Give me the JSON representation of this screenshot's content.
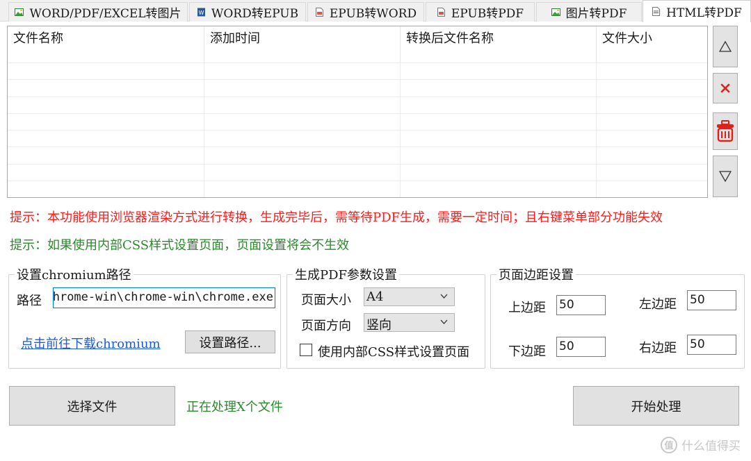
{
  "tabs": [
    {
      "label": "WORD/PDF/EXCEL转图片",
      "icon": "image-icon",
      "active": false
    },
    {
      "label": "WORD转EPUB",
      "icon": "word-doc-icon",
      "active": false
    },
    {
      "label": "EPUB转WORD",
      "icon": "epub-doc-icon",
      "active": false
    },
    {
      "label": "EPUB转PDF",
      "icon": "epub-doc-icon",
      "active": false
    },
    {
      "label": "图片转PDF",
      "icon": "image-icon",
      "active": false
    },
    {
      "label": "HTML转PDF",
      "icon": "html-doc-icon",
      "active": true
    }
  ],
  "file_list": {
    "columns": [
      "文件名称",
      "添加时间",
      "转换后文件名称",
      "文件大小"
    ],
    "rows": []
  },
  "side_buttons": {
    "move_up": "move-up-icon",
    "remove": "close-icon",
    "clear": "trash-icon",
    "move_down": "move-down-icon"
  },
  "hints": {
    "warning": "提示：本功能使用浏览器渲染方式进行转换，生成完毕后，需等待PDF生成，需要一定时间；且右键菜单部分功能失效",
    "info": "提示：如果使用内部CSS样式设置页面，页面设置将会不生效"
  },
  "chromium": {
    "group_title": "设置chromium路径",
    "path_label": "路径",
    "path_value": "hrome-win\\chrome-win\\chrome.exe",
    "download_link": "点击前往下载chromium",
    "set_path_button": "设置路径..."
  },
  "pdf_params": {
    "group_title": "生成PDF参数设置",
    "page_size_label": "页面大小",
    "page_size_value": "A4",
    "orientation_label": "页面方向",
    "orientation_value": "竖向",
    "use_css_label": "使用内部CSS样式设置页面",
    "use_css_checked": false
  },
  "margins": {
    "group_title": "页面边距设置",
    "top_label": "上边距",
    "top_value": "50",
    "left_label": "左边距",
    "left_value": "50",
    "bottom_label": "下边距",
    "bottom_value": "50",
    "right_label": "右边距",
    "right_value": "50"
  },
  "actions": {
    "select_files": "选择文件",
    "status": "正在处理X个文件",
    "start": "开始处理"
  },
  "watermark": {
    "logo_text": "值",
    "text": "什么值得买"
  },
  "colors": {
    "warning_text": "#ff1a1a",
    "info_text": "#2a8a2a",
    "link": "#1f5bd6",
    "focus_border": "#0078d7",
    "delete_red": "#e0201a"
  }
}
